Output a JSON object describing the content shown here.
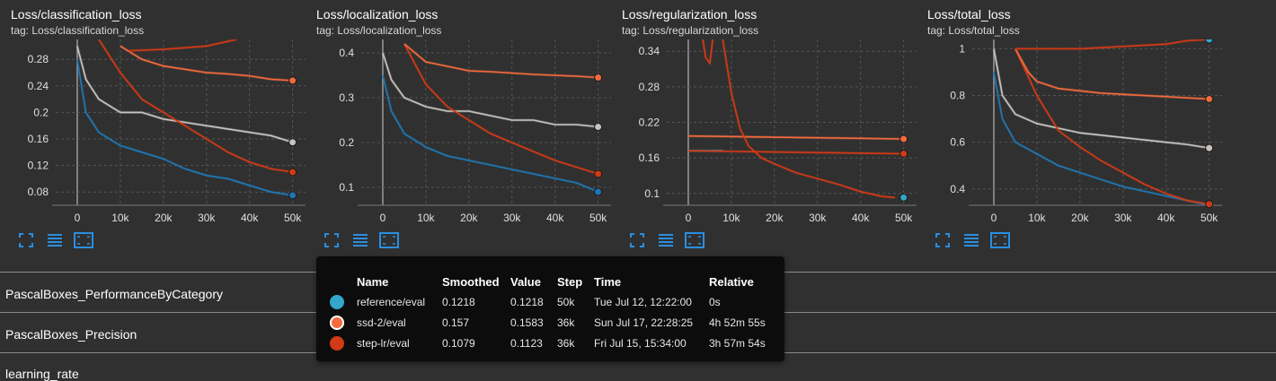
{
  "palette": {
    "blue": "#1f77b4",
    "gray": "#c9c3bf",
    "orange": "#f26a3d",
    "red": "#d13a16",
    "cyan": "#33a6cc"
  },
  "cards": [
    {
      "title": "Loss/classification_loss",
      "tag": "tag: Loss/classification_loss"
    },
    {
      "title": "Loss/localization_loss",
      "tag": "tag: Loss/localization_loss"
    },
    {
      "title": "Loss/regularization_loss",
      "tag": "tag: Loss/regularization_loss"
    },
    {
      "title": "Loss/total_loss",
      "tag": "tag: Loss/total_loss"
    }
  ],
  "chart_data": [
    {
      "type": "line",
      "title": "Loss/classification_loss",
      "xlim": [
        -5000,
        53000
      ],
      "ylim": [
        0.06,
        0.31
      ],
      "xticks": [
        0,
        10000,
        20000,
        30000,
        40000,
        50000
      ],
      "xtick_labels": [
        "0",
        "10k",
        "20k",
        "30k",
        "40k",
        "50k"
      ],
      "yticks": [
        0.08,
        0.12,
        0.16,
        0.2,
        0.24,
        0.28
      ],
      "ytick_labels": [
        "0.08",
        "0.12",
        "0.16",
        "0.2",
        "0.24",
        "0.28"
      ],
      "series": [
        {
          "color": "#1f77b4",
          "x": [
            0,
            2000,
            5000,
            10000,
            15000,
            20000,
            25000,
            30000,
            35000,
            40000,
            45000,
            50000
          ],
          "y": [
            0.28,
            0.2,
            0.17,
            0.15,
            0.14,
            0.13,
            0.115,
            0.105,
            0.1,
            0.09,
            0.08,
            0.075
          ],
          "endpoint": true
        },
        {
          "color": "#c9c3bf",
          "x": [
            0,
            2000,
            5000,
            10000,
            15000,
            20000,
            25000,
            30000,
            35000,
            40000,
            45000,
            50000
          ],
          "y": [
            0.3,
            0.25,
            0.22,
            0.2,
            0.2,
            0.19,
            0.185,
            0.18,
            0.175,
            0.17,
            0.165,
            0.155
          ],
          "endpoint": true
        },
        {
          "color": "#d13a16",
          "x": [
            5000,
            10000,
            15000,
            20000,
            25000,
            30000,
            35000,
            40000,
            45000,
            50000
          ],
          "y": [
            0.31,
            0.26,
            0.22,
            0.2,
            0.18,
            0.16,
            0.14,
            0.125,
            0.115,
            0.11
          ],
          "endpoint": true
        },
        {
          "color": "#f26a3d",
          "x": [
            10000,
            15000,
            20000,
            25000,
            30000,
            35000,
            40000,
            45000,
            50000
          ],
          "y": [
            0.3,
            0.28,
            0.27,
            0.265,
            0.26,
            0.258,
            0.255,
            0.25,
            0.248
          ],
          "endpoint": true
        },
        {
          "color": "#d13a16",
          "x": [
            12000,
            20000,
            30000,
            37000
          ],
          "y": [
            0.293,
            0.295,
            0.3,
            0.31
          ],
          "endpoint": false
        }
      ]
    },
    {
      "type": "line",
      "title": "Loss/localization_loss",
      "xlim": [
        -5000,
        53000
      ],
      "ylim": [
        0.06,
        0.43
      ],
      "xticks": [
        0,
        10000,
        20000,
        30000,
        40000,
        50000
      ],
      "xtick_labels": [
        "0",
        "10k",
        "20k",
        "30k",
        "40k",
        "50k"
      ],
      "yticks": [
        0.1,
        0.2,
        0.3,
        0.4
      ],
      "ytick_labels": [
        "0.1",
        "0.2",
        "0.3",
        "0.4"
      ],
      "series": [
        {
          "color": "#1f77b4",
          "x": [
            0,
            2000,
            5000,
            10000,
            15000,
            20000,
            25000,
            30000,
            35000,
            40000,
            45000,
            50000
          ],
          "y": [
            0.35,
            0.27,
            0.22,
            0.19,
            0.17,
            0.16,
            0.15,
            0.14,
            0.13,
            0.12,
            0.11,
            0.09
          ],
          "endpoint": true
        },
        {
          "color": "#c9c3bf",
          "x": [
            0,
            2000,
            5000,
            10000,
            15000,
            20000,
            25000,
            30000,
            35000,
            40000,
            45000,
            50000
          ],
          "y": [
            0.4,
            0.34,
            0.3,
            0.28,
            0.27,
            0.27,
            0.26,
            0.25,
            0.25,
            0.24,
            0.24,
            0.235
          ],
          "endpoint": true
        },
        {
          "color": "#d13a16",
          "x": [
            5000,
            10000,
            15000,
            20000,
            25000,
            30000,
            35000,
            40000,
            45000,
            50000
          ],
          "y": [
            0.42,
            0.33,
            0.28,
            0.25,
            0.22,
            0.2,
            0.18,
            0.16,
            0.145,
            0.13
          ],
          "endpoint": true
        },
        {
          "color": "#f26a3d",
          "x": [
            5000,
            10000,
            15000,
            20000,
            25000,
            30000,
            35000,
            40000,
            45000,
            50000
          ],
          "y": [
            0.42,
            0.38,
            0.37,
            0.36,
            0.358,
            0.355,
            0.352,
            0.35,
            0.348,
            0.345
          ],
          "endpoint": true
        }
      ]
    },
    {
      "type": "line",
      "title": "Loss/regularization_loss",
      "xlim": [
        -5000,
        53000
      ],
      "ylim": [
        0.08,
        0.36
      ],
      "xticks": [
        0,
        10000,
        20000,
        30000,
        40000,
        50000
      ],
      "xtick_labels": [
        "0",
        "10k",
        "20k",
        "30k",
        "40k",
        "50k"
      ],
      "yticks": [
        0.1,
        0.16,
        0.22,
        0.28,
        0.34
      ],
      "ytick_labels": [
        "0.1",
        "0.16",
        "0.22",
        "0.28",
        "0.34"
      ],
      "series": [
        {
          "color": "#33a6cc",
          "x": [
            0,
            8000
          ],
          "y": [
            0.172,
            0.172
          ],
          "endpoint": false
        },
        {
          "color": "#33a6cc",
          "x": [
            50000
          ],
          "y": [
            0.093
          ],
          "endpoint": true
        },
        {
          "color": "#d13a16",
          "x": [
            0,
            10000,
            20000,
            30000,
            40000,
            50000
          ],
          "y": [
            0.172,
            0.171,
            0.17,
            0.169,
            0.168,
            0.167
          ],
          "endpoint": true
        },
        {
          "color": "#f26a3d",
          "x": [
            0,
            10000,
            20000,
            30000,
            40000,
            50000
          ],
          "y": [
            0.197,
            0.196,
            0.195,
            0.194,
            0.193,
            0.192
          ],
          "endpoint": true
        },
        {
          "color": "#d13a16",
          "x": [
            3000,
            4000,
            5000,
            6000,
            8000,
            10000,
            12000,
            14000,
            17000,
            20000,
            25000,
            30000,
            35000,
            40000,
            45000,
            48000
          ],
          "y": [
            0.38,
            0.33,
            0.32,
            0.38,
            0.36,
            0.27,
            0.21,
            0.18,
            0.16,
            0.15,
            0.135,
            0.125,
            0.115,
            0.103,
            0.095,
            0.093
          ],
          "endpoint": false
        }
      ]
    },
    {
      "type": "line",
      "title": "Loss/total_loss",
      "xlim": [
        -5000,
        53000
      ],
      "ylim": [
        0.33,
        1.04
      ],
      "xticks": [
        0,
        10000,
        20000,
        30000,
        40000,
        50000
      ],
      "xtick_labels": [
        "0",
        "10k",
        "20k",
        "30k",
        "40k",
        "50k"
      ],
      "yticks": [
        0.4,
        0.6,
        0.8,
        1.0
      ],
      "ytick_labels": [
        "0.4",
        "0.6",
        "0.8",
        "1"
      ],
      "series": [
        {
          "color": "#1f77b4",
          "x": [
            0,
            2000,
            5000,
            10000,
            15000,
            20000,
            25000,
            30000,
            35000,
            40000,
            45000,
            50000
          ],
          "y": [
            0.9,
            0.7,
            0.6,
            0.55,
            0.5,
            0.47,
            0.44,
            0.41,
            0.39,
            0.37,
            0.35,
            0.33
          ],
          "endpoint": false
        },
        {
          "color": "#c9c3bf",
          "x": [
            0,
            2000,
            5000,
            10000,
            15000,
            20000,
            25000,
            30000,
            35000,
            40000,
            45000,
            50000
          ],
          "y": [
            1.0,
            0.8,
            0.72,
            0.68,
            0.66,
            0.64,
            0.63,
            0.62,
            0.61,
            0.6,
            0.59,
            0.575
          ],
          "endpoint": true
        },
        {
          "color": "#d13a16",
          "x": [
            5000,
            10000,
            15000,
            20000,
            25000,
            30000,
            35000,
            40000,
            45000,
            50000
          ],
          "y": [
            1.0,
            0.8,
            0.65,
            0.58,
            0.52,
            0.47,
            0.42,
            0.38,
            0.35,
            0.335
          ],
          "endpoint": true
        },
        {
          "color": "#f26a3d",
          "x": [
            5000,
            8000,
            10000,
            15000,
            20000,
            25000,
            30000,
            35000,
            40000,
            45000,
            50000
          ],
          "y": [
            1.0,
            0.9,
            0.86,
            0.83,
            0.82,
            0.81,
            0.805,
            0.8,
            0.795,
            0.79,
            0.785
          ],
          "endpoint": true
        },
        {
          "color": "#d13a16",
          "x": [
            5000,
            10000,
            20000,
            30000,
            40000,
            45000,
            50000
          ],
          "y": [
            1.0,
            1.0,
            1.0,
            1.01,
            1.02,
            1.035,
            1.04
          ],
          "endpoint": false
        },
        {
          "color": "#33a6cc",
          "x": [
            50000
          ],
          "y": [
            1.04
          ],
          "endpoint": true
        }
      ]
    }
  ],
  "sections": [
    {
      "label": "PascalBoxes_PerformanceByCategory"
    },
    {
      "label": "PascalBoxes_Precision"
    },
    {
      "label": "learning_rate"
    }
  ],
  "tooltip": {
    "headers": {
      "name": "Name",
      "smoothed": "Smoothed",
      "value": "Value",
      "step": "Step",
      "time": "Time",
      "relative": "Relative"
    },
    "rows": [
      {
        "color": "#33a6cc",
        "name": "reference/eval",
        "smoothed": "0.1218",
        "value": "0.1218",
        "step": "50k",
        "time": "Tue Jul 12, 12:22:00",
        "relative": "0s"
      },
      {
        "color": "#f26a3d",
        "name": "ssd-2/eval",
        "smoothed": "0.157",
        "value": "0.1583",
        "step": "36k",
        "time": "Sun Jul 17, 22:28:25",
        "relative": "4h 52m 55s"
      },
      {
        "color": "#d13a16",
        "name": "step-lr/eval",
        "smoothed": "0.1079",
        "value": "0.1123",
        "step": "36k",
        "time": "Fri Jul 15, 15:34:00",
        "relative": "3h 57m 54s"
      }
    ]
  }
}
